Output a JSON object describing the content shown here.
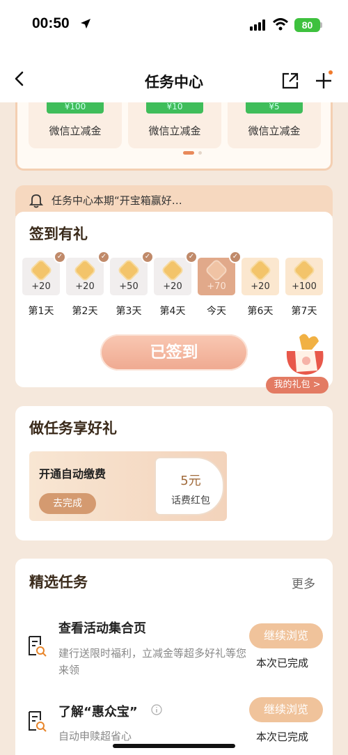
{
  "status": {
    "time": "00:50",
    "battery": "80"
  },
  "nav": {
    "title": "任务中心"
  },
  "coupons": [
    {
      "amount": "¥100",
      "label": "微信立减金"
    },
    {
      "amount": "¥10",
      "label": "微信立减金"
    },
    {
      "amount": "¥5",
      "label": "微信立减金"
    }
  ],
  "notice": {
    "text": "任务中心本期“开宝箱赢好…"
  },
  "checkin": {
    "title": "签到有礼",
    "days": [
      {
        "points": "+20",
        "label": "第1天"
      },
      {
        "points": "+20",
        "label": "第2天"
      },
      {
        "points": "+50",
        "label": "第3天"
      },
      {
        "points": "+20",
        "label": "第4天"
      },
      {
        "points": "+70",
        "label": "今天"
      },
      {
        "points": "+20",
        "label": "第6天"
      },
      {
        "points": "+100",
        "label": "第7天"
      }
    ],
    "button": "已签到",
    "gift_button": "我的礼包 >"
  },
  "tasks": {
    "title": "做任务享好礼",
    "promo_title": "开通自动缴费",
    "promo_button": "去完成",
    "ticket_amount": "5元",
    "ticket_label": "话费红包"
  },
  "selected": {
    "title": "精选任务",
    "more": "更多",
    "items": [
      {
        "name": "查看活动集合页",
        "desc": "建行送限时福利，立减金等超多好礼等您来领",
        "button": "继续浏览",
        "status": "本次已完成"
      },
      {
        "name": "了解“惠众宝”",
        "desc": "自动申赎超省心",
        "button": "继续浏览",
        "status": "本次已完成"
      }
    ]
  }
}
